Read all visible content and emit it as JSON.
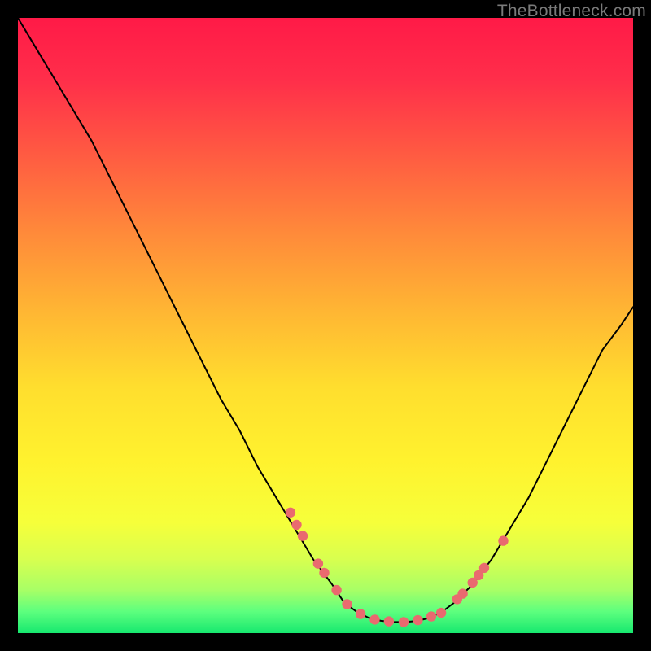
{
  "watermark": {
    "text": "TheBottleneck.com"
  },
  "gradient_stops": [
    {
      "offset": 0.0,
      "color": "#ff1a47"
    },
    {
      "offset": 0.1,
      "color": "#ff2e4a"
    },
    {
      "offset": 0.22,
      "color": "#ff5a42"
    },
    {
      "offset": 0.35,
      "color": "#ff8a3a"
    },
    {
      "offset": 0.48,
      "color": "#ffb733"
    },
    {
      "offset": 0.6,
      "color": "#ffde2e"
    },
    {
      "offset": 0.72,
      "color": "#fff22e"
    },
    {
      "offset": 0.82,
      "color": "#f6ff3a"
    },
    {
      "offset": 0.88,
      "color": "#d8ff4f"
    },
    {
      "offset": 0.93,
      "color": "#a8ff66"
    },
    {
      "offset": 0.965,
      "color": "#5dff7e"
    },
    {
      "offset": 1.0,
      "color": "#17e86f"
    }
  ],
  "chart_data": {
    "type": "line",
    "title": "",
    "xlabel": "",
    "ylabel": "",
    "xlim": [
      0,
      100
    ],
    "ylim": [
      0,
      100
    ],
    "grid": false,
    "legend": false,
    "series": [
      {
        "name": "bottleneck-curve",
        "x": [
          0,
          3,
          6,
          9,
          12,
          15,
          18,
          21,
          24,
          27,
          30,
          33,
          36,
          39,
          42,
          45,
          48,
          51,
          53,
          55,
          57,
          59,
          61,
          63,
          65,
          67,
          69,
          71,
          74,
          77,
          80,
          83,
          86,
          89,
          92,
          95,
          98,
          100
        ],
        "y": [
          100,
          95,
          90,
          85,
          80,
          74,
          68,
          62,
          56,
          50,
          44,
          38,
          33,
          27,
          22,
          17,
          12,
          8,
          5,
          3.5,
          2.5,
          2.0,
          1.8,
          1.8,
          2.0,
          2.5,
          3.5,
          5,
          8,
          12,
          17,
          22,
          28,
          34,
          40,
          46,
          50,
          53
        ]
      }
    ],
    "markers": {
      "name": "highlight-dots",
      "color": "#e96a6f",
      "points": [
        {
          "x": 44.3,
          "y": 19.6
        },
        {
          "x": 45.3,
          "y": 17.6
        },
        {
          "x": 46.3,
          "y": 15.8
        },
        {
          "x": 48.8,
          "y": 11.3
        },
        {
          "x": 49.8,
          "y": 9.8
        },
        {
          "x": 51.8,
          "y": 7.0
        },
        {
          "x": 53.5,
          "y": 4.7
        },
        {
          "x": 55.7,
          "y": 3.1
        },
        {
          "x": 58.0,
          "y": 2.2
        },
        {
          "x": 60.3,
          "y": 1.9
        },
        {
          "x": 62.7,
          "y": 1.8
        },
        {
          "x": 65.0,
          "y": 2.1
        },
        {
          "x": 67.2,
          "y": 2.7
        },
        {
          "x": 68.8,
          "y": 3.3
        },
        {
          "x": 71.4,
          "y": 5.5
        },
        {
          "x": 72.3,
          "y": 6.4
        },
        {
          "x": 73.9,
          "y": 8.2
        },
        {
          "x": 74.9,
          "y": 9.4
        },
        {
          "x": 75.8,
          "y": 10.6
        },
        {
          "x": 78.9,
          "y": 15.0
        }
      ]
    }
  }
}
